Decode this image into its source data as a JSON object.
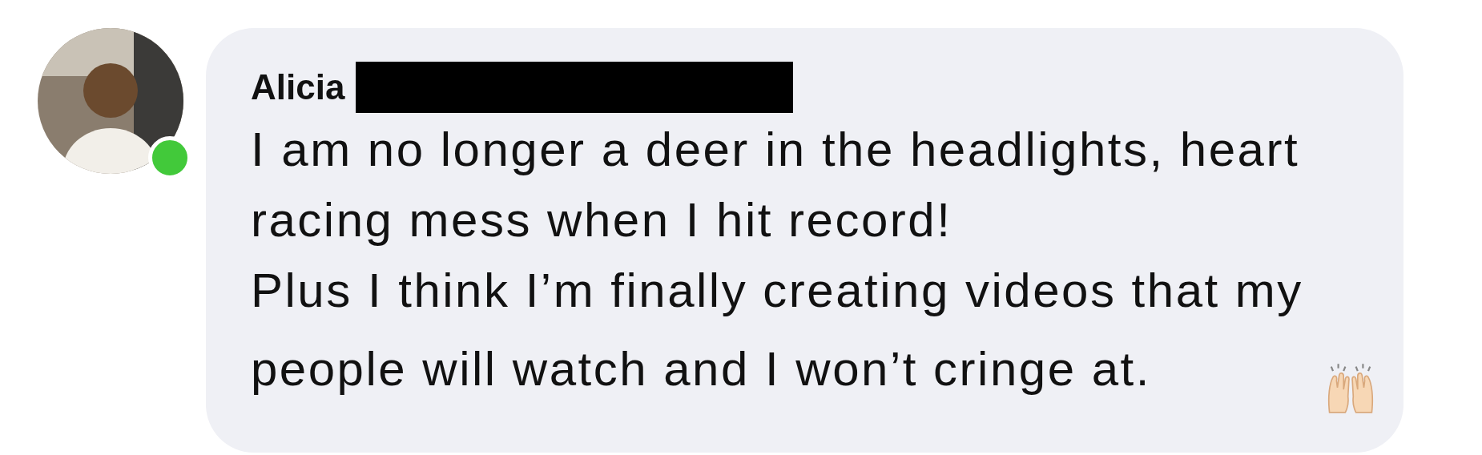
{
  "comment": {
    "author": "Alicia",
    "author_redacted": true,
    "online": true,
    "paragraphs": [
      "I am no longer a deer in the headlights, heart racing mess when I hit record!",
      "Plus I think I’m finally creating videos that my people will watch and I won’t cringe at."
    ]
  }
}
